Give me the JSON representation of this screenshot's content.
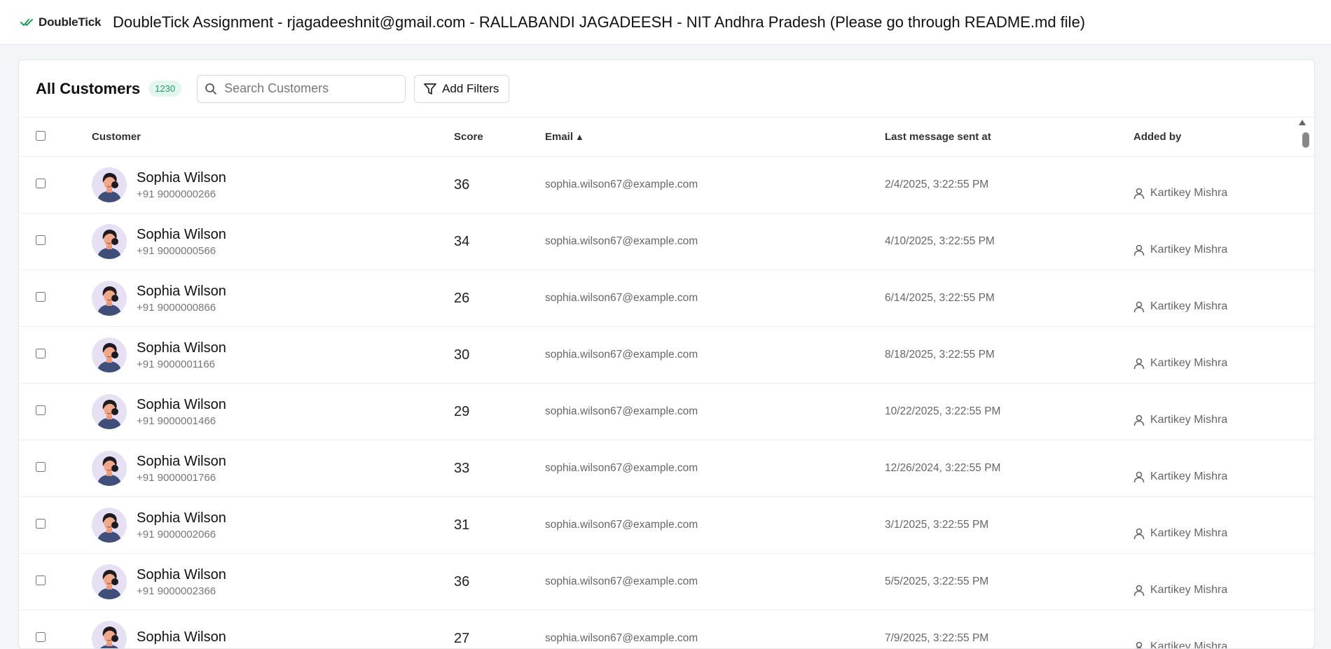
{
  "app": {
    "brand": "DoubleTick",
    "title": "DoubleTick Assignment - rjagadeeshnit@gmail.com - RALLABANDI JAGADEESH - NIT Andhra Pradesh (Please go through README.md file)",
    "accent_color": "#1f9d63"
  },
  "toolbar": {
    "title": "All Customers",
    "count": "1230",
    "search_placeholder": "Search Customers",
    "filter_label": "Add Filters"
  },
  "table": {
    "columns": {
      "customer": "Customer",
      "score": "Score",
      "email": "Email",
      "email_sort": "▲",
      "last_message": "Last message sent at",
      "added_by": "Added by"
    },
    "rows": [
      {
        "name": "Sophia Wilson",
        "phone": "+91 9000000266",
        "score": "36",
        "email": "sophia.wilson67@example.com",
        "last": "2/4/2025, 3:22:55 PM",
        "added_by": "Kartikey Mishra"
      },
      {
        "name": "Sophia Wilson",
        "phone": "+91 9000000566",
        "score": "34",
        "email": "sophia.wilson67@example.com",
        "last": "4/10/2025, 3:22:55 PM",
        "added_by": "Kartikey Mishra"
      },
      {
        "name": "Sophia Wilson",
        "phone": "+91 9000000866",
        "score": "26",
        "email": "sophia.wilson67@example.com",
        "last": "6/14/2025, 3:22:55 PM",
        "added_by": "Kartikey Mishra"
      },
      {
        "name": "Sophia Wilson",
        "phone": "+91 9000001166",
        "score": "30",
        "email": "sophia.wilson67@example.com",
        "last": "8/18/2025, 3:22:55 PM",
        "added_by": "Kartikey Mishra"
      },
      {
        "name": "Sophia Wilson",
        "phone": "+91 9000001466",
        "score": "29",
        "email": "sophia.wilson67@example.com",
        "last": "10/22/2025, 3:22:55 PM",
        "added_by": "Kartikey Mishra"
      },
      {
        "name": "Sophia Wilson",
        "phone": "+91 9000001766",
        "score": "33",
        "email": "sophia.wilson67@example.com",
        "last": "12/26/2024, 3:22:55 PM",
        "added_by": "Kartikey Mishra"
      },
      {
        "name": "Sophia Wilson",
        "phone": "+91 9000002066",
        "score": "31",
        "email": "sophia.wilson67@example.com",
        "last": "3/1/2025, 3:22:55 PM",
        "added_by": "Kartikey Mishra"
      },
      {
        "name": "Sophia Wilson",
        "phone": "+91 9000002366",
        "score": "36",
        "email": "sophia.wilson67@example.com",
        "last": "5/5/2025, 3:22:55 PM",
        "added_by": "Kartikey Mishra"
      },
      {
        "name": "Sophia Wilson",
        "phone": "",
        "score": "27",
        "email": "sophia.wilson67@example.com",
        "last": "7/9/2025, 3:22:55 PM",
        "added_by": "Kartikey Mishra"
      }
    ]
  }
}
